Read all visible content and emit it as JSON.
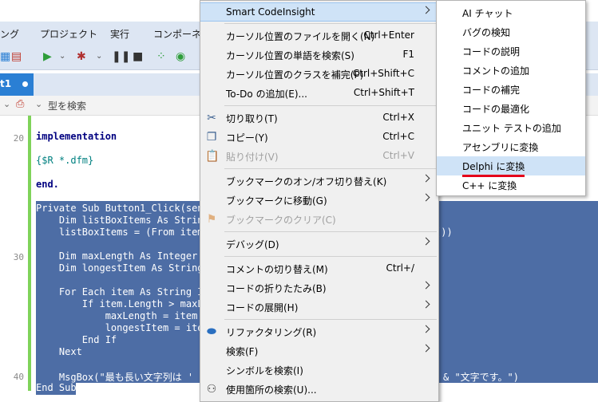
{
  "ide": {
    "menu": [
      "ング",
      "プロジェクト",
      "実行",
      "コンポーネン"
    ],
    "tab_label": "t1",
    "type_search": "型を検索",
    "line_numbers": [
      "20",
      "30",
      "40"
    ],
    "code_lines": [
      "implementation",
      "{$R *.dfm}",
      "end.",
      "Private Sub Button1_Click(send",
      "    Dim listBoxItems As String",
      "    listBoxItems = (From item",
      "    Dim maxLength As Integer =",
      "    Dim longestItem As String",
      "    For Each item As String In",
      "        If item.Length > maxLe",
      "            maxLength = item.",
      "            longestItem = ite",
      "        End If",
      "    Next",
      "    MsgBox(\"最も長い文字列は '",
      "End Sub"
    ],
    "code_tail_1": "())",
    "code_tail_2": "& \"文字です。\")"
  },
  "context_menu": {
    "items": [
      {
        "label": "Smart CodeInsight",
        "shortcut": "",
        "submenu": true,
        "disabled": false
      },
      {
        "label": "カーソル位置のファイルを開く(N)",
        "shortcut": "Ctrl+Enter",
        "submenu": false,
        "disabled": false
      },
      {
        "label": "カーソル位置の単語を検索(S)",
        "shortcut": "F1",
        "submenu": false,
        "disabled": false
      },
      {
        "label": "カーソル位置のクラスを補完(P)",
        "shortcut": "Ctrl+Shift+C",
        "submenu": false,
        "disabled": false
      },
      {
        "label": "To-Do の追加(E)...",
        "shortcut": "Ctrl+Shift+T",
        "submenu": false,
        "disabled": false
      },
      {
        "label": "切り取り(T)",
        "shortcut": "Ctrl+X",
        "submenu": false,
        "disabled": false,
        "icon": "scissors-icon"
      },
      {
        "label": "コピー(Y)",
        "shortcut": "Ctrl+C",
        "submenu": false,
        "disabled": false,
        "icon": "copy-icon"
      },
      {
        "label": "貼り付け(V)",
        "shortcut": "Ctrl+V",
        "submenu": false,
        "disabled": true,
        "icon": "paste-icon"
      },
      {
        "label": "ブックマークのオン/オフ切り替え(K)",
        "shortcut": "",
        "submenu": true,
        "disabled": false
      },
      {
        "label": "ブックマークに移動(G)",
        "shortcut": "",
        "submenu": true,
        "disabled": false
      },
      {
        "label": "ブックマークのクリア(C)",
        "shortcut": "",
        "submenu": false,
        "disabled": true,
        "icon": "bookmark-clear-icon"
      },
      {
        "label": "デバッグ(D)",
        "shortcut": "",
        "submenu": true,
        "disabled": false
      },
      {
        "label": "コメントの切り替え(M)",
        "shortcut": "Ctrl+/",
        "submenu": false,
        "disabled": false
      },
      {
        "label": "コードの折りたたみ(B)",
        "shortcut": "",
        "submenu": true,
        "disabled": false
      },
      {
        "label": "コードの展開(H)",
        "shortcut": "",
        "submenu": true,
        "disabled": false
      },
      {
        "label": "リファクタリング(R)",
        "shortcut": "",
        "submenu": true,
        "disabled": false,
        "icon": "refactor-icon"
      },
      {
        "label": "検索(F)",
        "shortcut": "",
        "submenu": true,
        "disabled": false
      },
      {
        "label": "シンボルを検索(I)",
        "shortcut": "",
        "submenu": false,
        "disabled": false
      },
      {
        "label": "使用箇所の検索(U)...",
        "shortcut": "",
        "submenu": false,
        "disabled": false,
        "icon": "usages-icon"
      }
    ]
  },
  "submenu": {
    "items": [
      "AI チャット",
      "バグの検知",
      "コードの説明",
      "コメントの追加",
      "コードの補完",
      "コードの最適化",
      "ユニット テストの追加",
      "アセンブリに変換",
      "Delphi に変換",
      "C++ に変換"
    ],
    "highlighted": "Delphi に変換"
  },
  "colors": {
    "highlight": "#cfe3f7",
    "selection": "#4d6da5",
    "accent_underline": "#e4001b",
    "tab_active": "#2a7fd4"
  }
}
